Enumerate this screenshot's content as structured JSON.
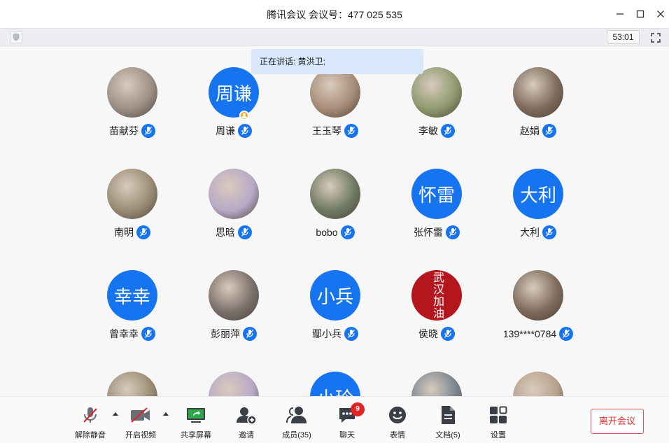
{
  "window": {
    "title": "腾讯会议 会议号：477 025 535"
  },
  "status": {
    "timer": "53:01",
    "speaking": "正在讲话: 黄洪卫;"
  },
  "participants": [
    {
      "name": "苗献芬",
      "avatar_text": "",
      "photo": true
    },
    {
      "name": "周谦",
      "avatar_text": "周谦",
      "photo": false,
      "host": true
    },
    {
      "name": "王玉琴",
      "avatar_text": "",
      "photo": true
    },
    {
      "name": "李敏",
      "avatar_text": "",
      "photo": true
    },
    {
      "name": "赵娟",
      "avatar_text": "",
      "photo": true
    },
    {
      "name": "南明",
      "avatar_text": "",
      "photo": true
    },
    {
      "name": "思晗",
      "avatar_text": "",
      "photo": true
    },
    {
      "name": "bobo",
      "avatar_text": "",
      "photo": true
    },
    {
      "name": "张怀雷",
      "avatar_text": "怀雷",
      "photo": false
    },
    {
      "name": "大利",
      "avatar_text": "大利",
      "photo": false
    },
    {
      "name": "曾幸幸",
      "avatar_text": "幸幸",
      "photo": false
    },
    {
      "name": "彭丽萍",
      "avatar_text": "",
      "photo": true
    },
    {
      "name": "鄢小兵",
      "avatar_text": "小兵",
      "photo": false
    },
    {
      "name": "侯晓",
      "avatar_text": "武汉加油",
      "photo": true
    },
    {
      "name": "139****0784",
      "avatar_text": "",
      "photo": true
    },
    {
      "name": "",
      "avatar_text": "",
      "photo": true
    },
    {
      "name": "",
      "avatar_text": "",
      "photo": true
    },
    {
      "name": "",
      "avatar_text": "小玲",
      "photo": false
    },
    {
      "name": "",
      "avatar_text": "",
      "photo": true
    },
    {
      "name": "",
      "avatar_text": "",
      "photo": true
    }
  ],
  "toolbar": {
    "unmute": "解除静音",
    "start_video": "开启视频",
    "share_screen": "共享屏幕",
    "invite": "邀请",
    "members": "成员(35)",
    "chat": "聊天",
    "chat_badge": "9",
    "emoji": "表情",
    "docs": "文档(5)",
    "settings": "设置",
    "leave": "离开会议"
  },
  "colors": {
    "accent": "#1774f0",
    "speaking_bg": "#d8e8fa",
    "leave_red": "#e03131",
    "badge_red": "#e02424",
    "share_green": "#2aa84a"
  }
}
